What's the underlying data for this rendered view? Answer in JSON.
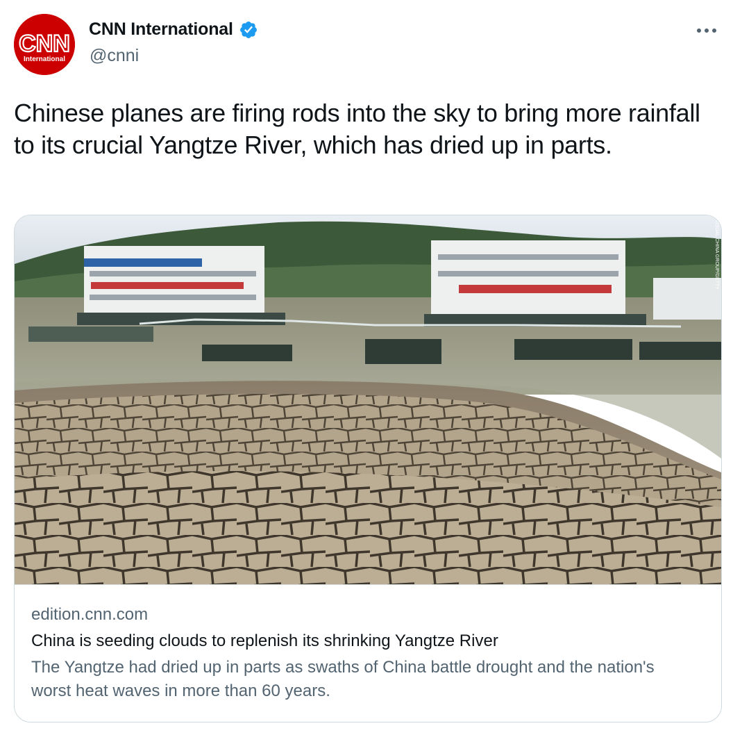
{
  "author": {
    "display_name": "CNN International",
    "handle": "@cnni",
    "avatar_logo_text": "CNN",
    "avatar_sub_text": "International",
    "avatar_color": "#cc0000",
    "verified_color": "#1d9bf0"
  },
  "tweet": {
    "text": "Chinese planes are firing rods into the sky to bring more rainfall to its crucial Yangtze River, which has dried up in parts."
  },
  "card": {
    "image_icon": "dried-riverbed-photo",
    "image_credit": "VISUAL CHINA GROUP/GETTY",
    "domain": "edition.cnn.com",
    "title": "China is seeding clouds to replenish its shrinking Yangtze River",
    "description": "The Yangtze had dried up in parts as swaths of China battle drought and the nation's worst heat waves in more than 60 years."
  },
  "icons": {
    "more": "more-options-icon",
    "verified": "verified-badge-icon"
  }
}
